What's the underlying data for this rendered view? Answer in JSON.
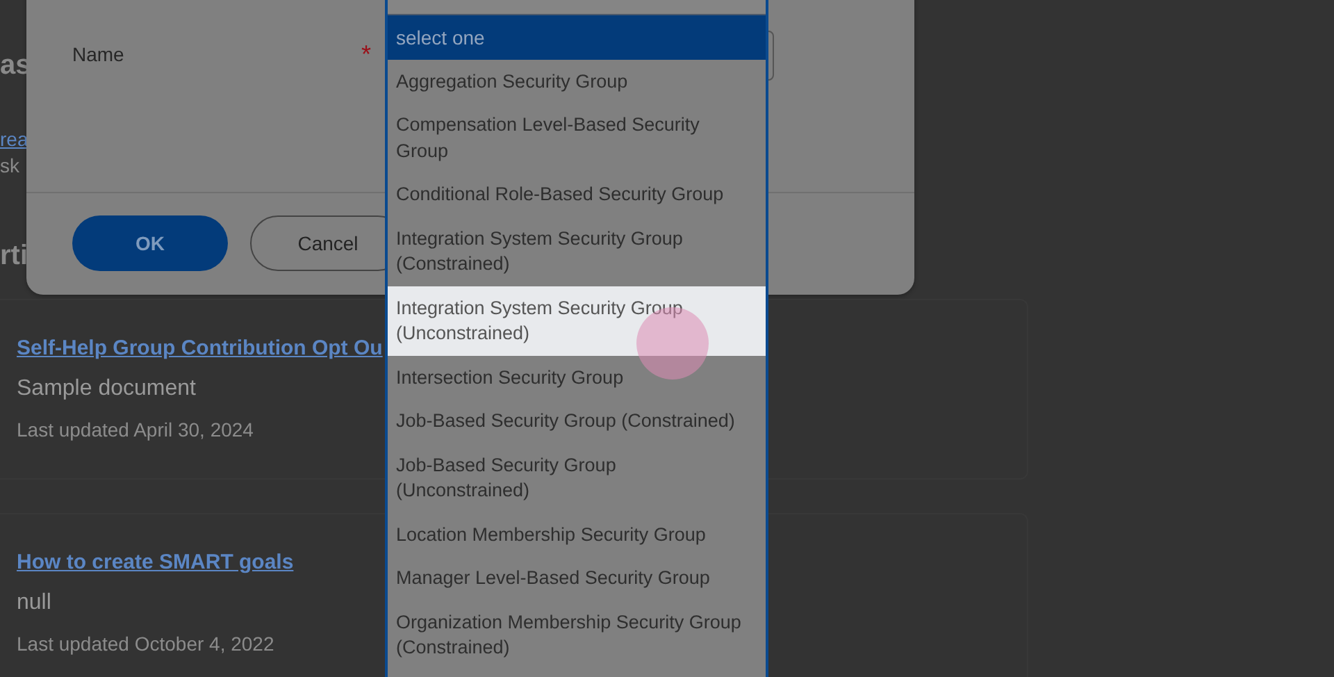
{
  "page": {
    "heading_fragment": "as",
    "link_fragment": "rea",
    "text_fragment": "sk",
    "section_heading_fragment": "rti",
    "cards": [
      {
        "title": "Self-Help Group Contribution Opt Ou",
        "description": "Sample document",
        "updated": "Last updated April 30, 2024"
      },
      {
        "title": "How to create SMART goals",
        "description": "null",
        "updated": "Last updated October 4, 2022"
      }
    ]
  },
  "dialog": {
    "field_label": "Name",
    "required_mark": "*",
    "buttons": [
      {
        "label": "OK",
        "kind": "primary"
      },
      {
        "label": "Cancel",
        "kind": "secondary"
      }
    ]
  },
  "dropdown": {
    "header": "select one",
    "options": [
      {
        "label": "Aggregation Security Group",
        "highlighted": false
      },
      {
        "label": "Compensation Level-Based Security Group",
        "highlighted": false
      },
      {
        "label": "Conditional Role-Based Security Group",
        "highlighted": false
      },
      {
        "label": "Integration System Security Group (Constrained)",
        "highlighted": false
      },
      {
        "label": "Integration System Security Group (Unconstrained)",
        "highlighted": true
      },
      {
        "label": "Intersection Security Group",
        "highlighted": false
      },
      {
        "label": "Job-Based Security Group (Constrained)",
        "highlighted": false
      },
      {
        "label": "Job-Based Security Group (Unconstrained)",
        "highlighted": false
      },
      {
        "label": "Location Membership Security Group",
        "highlighted": false
      },
      {
        "label": "Manager Level-Based Security Group",
        "highlighted": false
      },
      {
        "label": "Organization Membership Security Group (Constrained)",
        "highlighted": false
      }
    ]
  }
}
